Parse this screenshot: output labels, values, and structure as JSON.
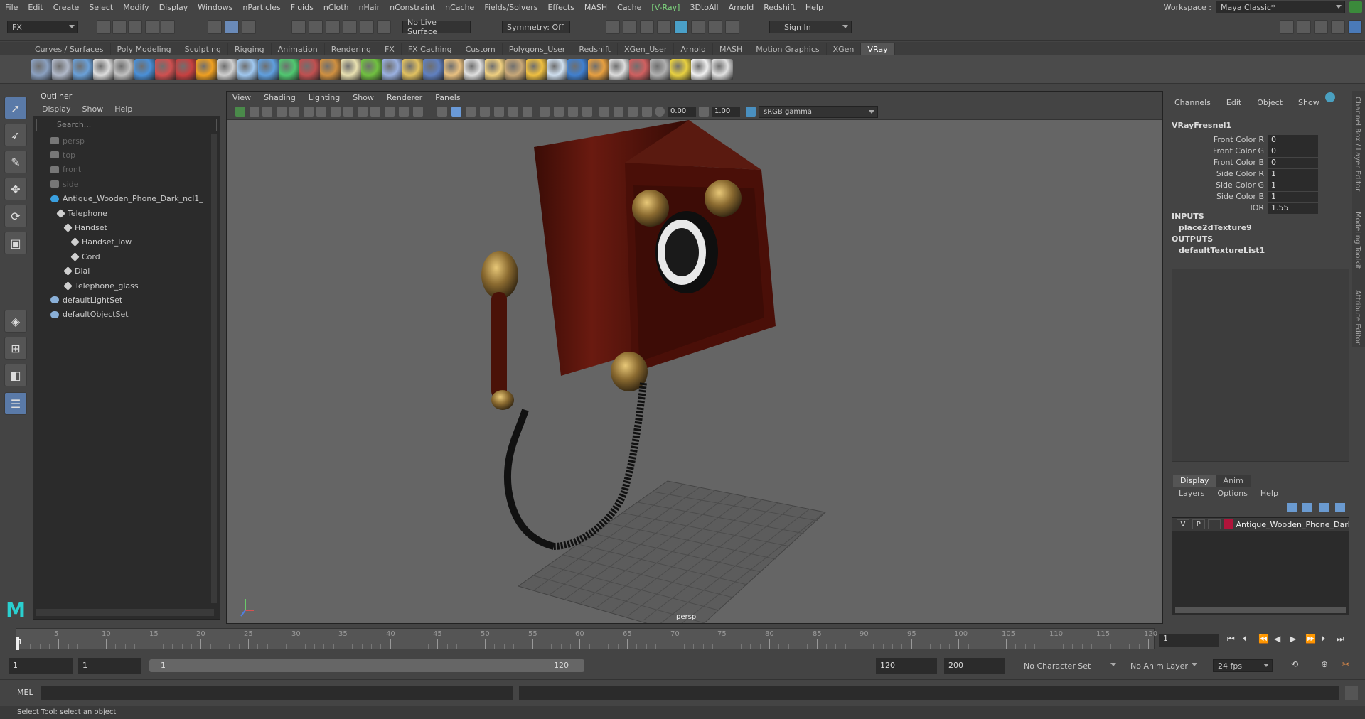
{
  "menubar": {
    "items": [
      "File",
      "Edit",
      "Create",
      "Select",
      "Modify",
      "Display",
      "Windows",
      "nParticles",
      "Fluids",
      "nCloth",
      "nHair",
      "nConstraint",
      "nCache",
      "Fields/Solvers",
      "Effects",
      "MASH",
      "Cache",
      "[V-Ray]",
      "3DtoAll",
      "Arnold",
      "Redshift",
      "Help"
    ],
    "workspace_label": "Workspace :",
    "workspace_value": "Maya Classic*"
  },
  "statusline": {
    "mode": "FX",
    "live_surface": "No Live Surface",
    "symmetry": "Symmetry: Off",
    "sign_in": "Sign In"
  },
  "shelf": {
    "tabs": [
      "Curves / Surfaces",
      "Poly Modeling",
      "Sculpting",
      "Rigging",
      "Animation",
      "Rendering",
      "FX",
      "FX Caching",
      "Custom",
      "Polygons_User",
      "Redshift",
      "XGen_User",
      "Arnold",
      "MASH",
      "Motion Graphics",
      "XGen",
      "VRay"
    ],
    "active_tab": "VRay",
    "icon_colors": [
      "#8aa0c0",
      "#b0b8c8",
      "#6aa0d8",
      "#dddddd",
      "#c0c0c0",
      "#4a90d8",
      "#d05050",
      "#c84040",
      "#f0a020",
      "#d0d0d0",
      "#a0c8f0",
      "#60a0e0",
      "#50c870",
      "#c05050",
      "#d09040",
      "#e8e0b0",
      "#70c040",
      "#9ab0e0",
      "#e0c060",
      "#6080c0",
      "#e8c080",
      "#e0e0e0",
      "#f0d080",
      "#c8a878",
      "#f0c040",
      "#d0e0f0",
      "#4080d0",
      "#e8a040",
      "#dddddd",
      "#d06060",
      "#b0b0b0",
      "#e8d040",
      "#f0f0f0",
      "#e0e0e0"
    ]
  },
  "outliner": {
    "title": "Outliner",
    "menu": [
      "Display",
      "Show",
      "Help"
    ],
    "search_placeholder": "Search...",
    "rows": [
      {
        "label": "persp",
        "dim": true,
        "icon": "camera-icon",
        "depth": 0
      },
      {
        "label": "top",
        "dim": true,
        "icon": "camera-icon",
        "depth": 0
      },
      {
        "label": "front",
        "dim": true,
        "icon": "camera-icon",
        "depth": 0
      },
      {
        "label": "side",
        "dim": true,
        "icon": "camera-icon",
        "depth": 0
      },
      {
        "label": "Antique_Wooden_Phone_Dark_ncl1_",
        "dim": false,
        "icon": "asterisk-icon",
        "depth": 0
      },
      {
        "label": "Telephone",
        "dim": false,
        "icon": "transform-icon",
        "depth": 1
      },
      {
        "label": "Handset",
        "dim": false,
        "icon": "transform-icon",
        "depth": 2
      },
      {
        "label": "Handset_low",
        "dim": false,
        "icon": "transform-icon",
        "depth": 3
      },
      {
        "label": "Cord",
        "dim": false,
        "icon": "transform-icon",
        "depth": 3
      },
      {
        "label": "Dial",
        "dim": false,
        "icon": "transform-icon",
        "depth": 2
      },
      {
        "label": "Telephone_glass",
        "dim": false,
        "icon": "transform-icon",
        "depth": 2
      },
      {
        "label": "defaultLightSet",
        "dim": false,
        "icon": "set-icon",
        "depth": 0
      },
      {
        "label": "defaultObjectSet",
        "dim": false,
        "icon": "set-icon",
        "depth": 0
      }
    ]
  },
  "viewport": {
    "menu": [
      "View",
      "Shading",
      "Lighting",
      "Show",
      "Renderer",
      "Panels"
    ],
    "exposure": "0.00",
    "gamma": "1.00",
    "color_space": "sRGB gamma",
    "camera_label": "persp"
  },
  "channelbox": {
    "menu": [
      "Channels",
      "Edit",
      "Object",
      "Show"
    ],
    "node": "VRayFresnel1",
    "attrs": [
      {
        "label": "Front Color R",
        "value": "0"
      },
      {
        "label": "Front Color G",
        "value": "0"
      },
      {
        "label": "Front Color B",
        "value": "0"
      },
      {
        "label": "Side Color R",
        "value": "1"
      },
      {
        "label": "Side Color G",
        "value": "1"
      },
      {
        "label": "Side Color B",
        "value": "1"
      },
      {
        "label": "IOR",
        "value": "1.55"
      }
    ],
    "inputs_label": "INPUTS",
    "input_item": "place2dTexture9",
    "outputs_label": "OUTPUTS",
    "output_item": "defaultTextureList1"
  },
  "layereditor": {
    "tabs": [
      "Display",
      "Anim"
    ],
    "menu": [
      "Layers",
      "Options",
      "Help"
    ],
    "layer": {
      "v": "V",
      "p": "P",
      "name": "Antique_Wooden_Phone_Dark",
      "color": "#b0143a"
    }
  },
  "sidetabs": [
    "Channel Box / Layer Editor",
    "Modeling Toolkit",
    "Attribute Editor"
  ],
  "timeslider": {
    "ticks": [
      "5",
      "10",
      "15",
      "20",
      "25",
      "30",
      "35",
      "40",
      "45",
      "50",
      "55",
      "60",
      "65",
      "70",
      "75",
      "80",
      "85",
      "90",
      "95",
      "100",
      "105",
      "110",
      "115",
      "120"
    ],
    "current_frame": "1",
    "start_marker": "1"
  },
  "range": {
    "start": "1",
    "playback_start": "1",
    "slider_start": "1",
    "slider_end": "120",
    "playback_end": "120",
    "end": "200",
    "character_set": "No Character Set",
    "anim_layer": "No Anim Layer",
    "fps": "24 fps"
  },
  "cmdline": {
    "label": "MEL"
  },
  "helpline": {
    "text": "Select Tool: select an object"
  }
}
